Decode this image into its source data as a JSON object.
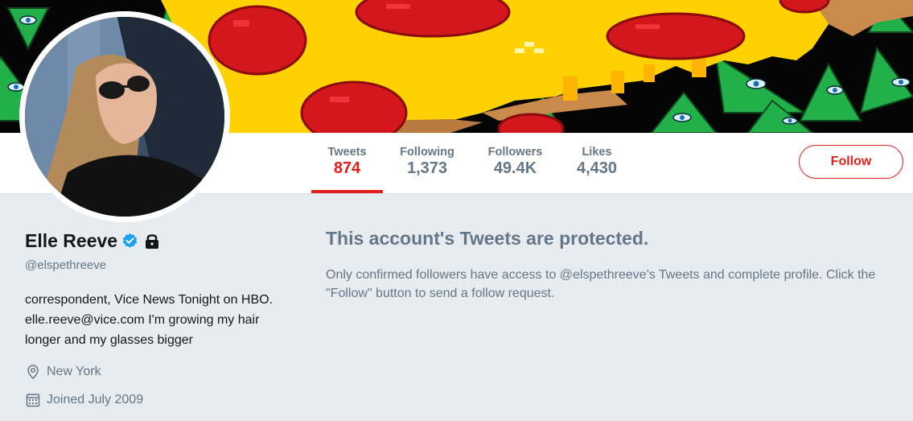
{
  "profile": {
    "name": "Elle Reeve",
    "handle": "@elspethreeve",
    "bio": "correspondent, Vice News Tonight on HBO. elle.reeve@vice.com I'm growing my hair longer and my glasses bigger",
    "location": "New York",
    "joined": "Joined July 2009",
    "verified": true,
    "protected": true
  },
  "stats": [
    {
      "label": "Tweets",
      "value": "874",
      "active": true
    },
    {
      "label": "Following",
      "value": "1,373",
      "active": false
    },
    {
      "label": "Followers",
      "value": "49.4K",
      "active": false
    },
    {
      "label": "Likes",
      "value": "4,430",
      "active": false
    }
  ],
  "follow_button": {
    "label": "Follow"
  },
  "protected_notice": {
    "title": "This account's Tweets are protected.",
    "message": "Only confirmed followers have access to @elspethreeve's Tweets and complete profile. Click the \"Follow\" button to send a follow request."
  },
  "icons": {
    "verified": "verified-badge-icon",
    "lock": "lock-icon",
    "location": "location-pin-icon",
    "calendar": "calendar-icon"
  },
  "colors": {
    "accent": "#e0201b",
    "verified": "#1da1f2",
    "muted": "#657786",
    "text": "#14171a",
    "page_bg": "#e6ecf0"
  }
}
